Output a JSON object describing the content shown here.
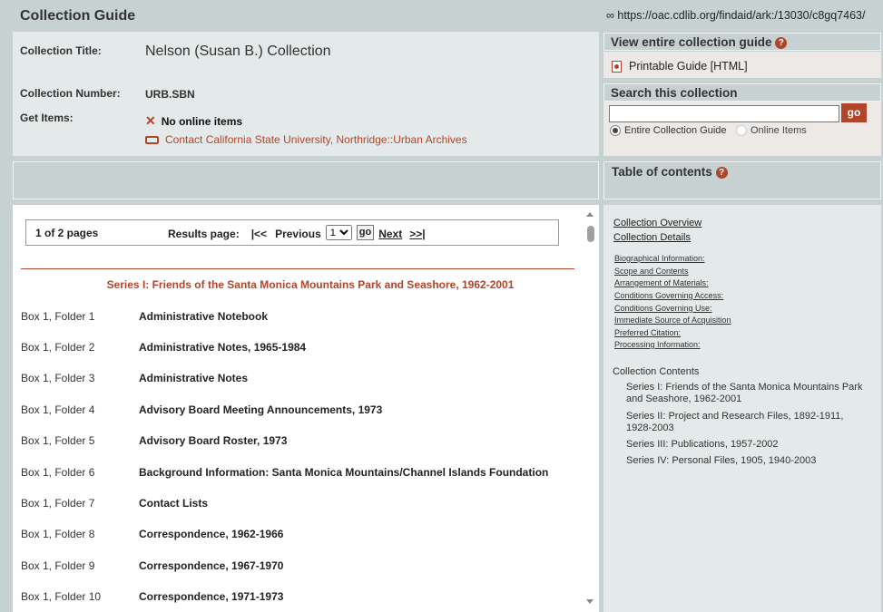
{
  "header": {
    "title": "Collection Guide",
    "url": "∞ https://oac.cdlib.org/findaid/ark:/13030/c8gq7463/"
  },
  "meta": {
    "title_label": "Collection Title:",
    "title_value": "Nelson (Susan B.) Collection",
    "number_label": "Collection Number:",
    "number_value": "URB.SBN",
    "get_items_label": "Get Items:",
    "no_online": "No online items",
    "contact": "Contact California State University, Northridge::Urban Archives"
  },
  "pager": {
    "count": "1 of 2 pages",
    "results_label": "Results page:",
    "first": "|<<",
    "previous": "Previous",
    "page_value": "1",
    "go": "go",
    "next": "Next",
    "last": ">>|"
  },
  "series_heading": "Series I: Friends of the Santa Monica Mountains Park and Seashore, 1962-2001",
  "rows": [
    {
      "loc": "Box 1, Folder 1",
      "title": "Administrative Notebook"
    },
    {
      "loc": "Box 1, Folder 2",
      "title": "Administrative Notes, 1965-1984"
    },
    {
      "loc": "Box 1, Folder 3",
      "title": "Administrative Notes"
    },
    {
      "loc": "Box 1, Folder 4",
      "title": "Advisory Board Meeting Announcements, 1973"
    },
    {
      "loc": "Box 1, Folder 5",
      "title": "Advisory Board Roster, 1973"
    },
    {
      "loc": "Box 1, Folder 6",
      "title": "Background Information: Santa Monica Mountains/Channel Islands Foundation"
    },
    {
      "loc": "Box 1, Folder 7",
      "title": "Contact Lists"
    },
    {
      "loc": "Box 1, Folder 8",
      "title": "Correspondence, 1962-1966"
    },
    {
      "loc": "Box 1, Folder 9",
      "title": "Correspondence, 1967-1970"
    },
    {
      "loc": "Box 1, Folder 10",
      "title": "Correspondence, 1971-1973"
    }
  ],
  "sidebar": {
    "view_guide_title": "View entire collection guide",
    "printable_guide": "Printable Guide [HTML]",
    "search_title": "Search this collection",
    "search_go": "go",
    "search_value": "",
    "radio_entire": "Entire Collection Guide",
    "radio_online": "Online Items",
    "toc_title": "Table of contents",
    "toc_main": [
      "Collection Overview",
      "Collection Details"
    ],
    "toc_sub": [
      "Biographical Information:",
      "Scope and Contents",
      "Arrangement of Materials:",
      "Conditions Governing Access:",
      "Conditions Governing Use:",
      "Immediate Source of Acquisition",
      "Preferred Citation:",
      "Processing Information:"
    ],
    "contents_label": "Collection Contents",
    "toc_series": [
      "Series I: Friends of the Santa Monica Mountains Park and Seashore, 1962-2001",
      "Series II: Project and Research Files, 1892-1911, 1928-2003",
      "Series III: Publications, 1957-2002",
      "Series IV: Personal Files, 1905, 1940-2003"
    ]
  },
  "colors": {
    "accent": "#b0452a",
    "frame": "#c7d1d1",
    "panel": "#e4e9e9"
  }
}
